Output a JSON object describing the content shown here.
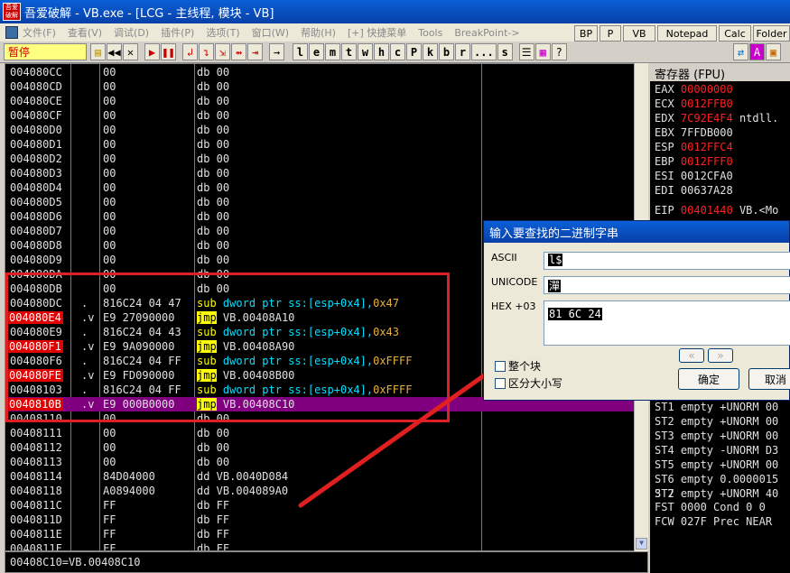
{
  "window": {
    "title": "吾爱破解 - VB.exe - [LCG - 主线程, 模块 - VB]",
    "logo": "吾爱破解"
  },
  "menu": [
    "文件(F)",
    "查看(V)",
    "调试(D)",
    "插件(P)",
    "选项(T)",
    "窗口(W)",
    "帮助(H)",
    "[+] 快捷菜单",
    "Tools",
    "BreakPoint->"
  ],
  "toolbar": {
    "status": "暂停",
    "letters": [
      "l",
      "e",
      "m",
      "t",
      "w",
      "h",
      "c",
      "P",
      "k",
      "b",
      "r",
      "...",
      "s"
    ],
    "right_buttons": [
      "BP",
      "P",
      "VB",
      "Notepad",
      "Calc",
      "Folder"
    ]
  },
  "disasm": [
    {
      "addr": "004080CC",
      "mark": "",
      "hex": "00",
      "dis": "db 00",
      "hl": ""
    },
    {
      "addr": "004080CD",
      "mark": "",
      "hex": "00",
      "dis": "db 00",
      "hl": ""
    },
    {
      "addr": "004080CE",
      "mark": "",
      "hex": "00",
      "dis": "db 00",
      "hl": ""
    },
    {
      "addr": "004080CF",
      "mark": "",
      "hex": "00",
      "dis": "db 00",
      "hl": ""
    },
    {
      "addr": "004080D0",
      "mark": "",
      "hex": "00",
      "dis": "db 00",
      "hl": ""
    },
    {
      "addr": "004080D1",
      "mark": "",
      "hex": "00",
      "dis": "db 00",
      "hl": ""
    },
    {
      "addr": "004080D2",
      "mark": "",
      "hex": "00",
      "dis": "db 00",
      "hl": ""
    },
    {
      "addr": "004080D3",
      "mark": "",
      "hex": "00",
      "dis": "db 00",
      "hl": ""
    },
    {
      "addr": "004080D4",
      "mark": "",
      "hex": "00",
      "dis": "db 00",
      "hl": ""
    },
    {
      "addr": "004080D5",
      "mark": "",
      "hex": "00",
      "dis": "db 00",
      "hl": ""
    },
    {
      "addr": "004080D6",
      "mark": "",
      "hex": "00",
      "dis": "db 00",
      "hl": ""
    },
    {
      "addr": "004080D7",
      "mark": "",
      "hex": "00",
      "dis": "db 00",
      "hl": ""
    },
    {
      "addr": "004080D8",
      "mark": "",
      "hex": "00",
      "dis": "db 00",
      "hl": ""
    },
    {
      "addr": "004080D9",
      "mark": "",
      "hex": "00",
      "dis": "db 00",
      "hl": ""
    },
    {
      "addr": "004080DA",
      "mark": "",
      "hex": "00",
      "dis": "db 00",
      "hl": ""
    },
    {
      "addr": "004080DB",
      "mark": "",
      "hex": "00",
      "dis": "db 00",
      "hl": ""
    },
    {
      "addr": "004080DC",
      "mark": ".",
      "hex": "816C24 04 47",
      "op": "sub",
      "arg": "dword ptr ss:[esp+0x4],",
      "num": "0x47",
      "hl": ""
    },
    {
      "addr": "004080E4",
      "mark": ".v",
      "hex": "E9 27090000",
      "op": "jmp",
      "arg": "VB.00408A10",
      "num": "",
      "hl": "red"
    },
    {
      "addr": "004080E9",
      "mark": ".",
      "hex": "816C24 04 43",
      "op": "sub",
      "arg": "dword ptr ss:[esp+0x4],",
      "num": "0x43",
      "hl": ""
    },
    {
      "addr": "004080F1",
      "mark": ".v",
      "hex": "E9 9A090000",
      "op": "jmp",
      "arg": "VB.00408A90",
      "num": "",
      "hl": "red"
    },
    {
      "addr": "004080F6",
      "mark": ".",
      "hex": "816C24 04 FF",
      "op": "sub",
      "arg": "dword ptr ss:[esp+0x4],",
      "num": "0xFFFF",
      "hl": ""
    },
    {
      "addr": "004080FE",
      "mark": ".v",
      "hex": "E9 FD090000",
      "op": "jmp",
      "arg": "VB.00408B00",
      "num": "",
      "hl": "red"
    },
    {
      "addr": "00408103",
      "mark": ".",
      "hex": "816C24 04 FF",
      "op": "sub",
      "arg": "dword ptr ss:[esp+0x4],",
      "num": "0xFFFF",
      "hl": ""
    },
    {
      "addr": "0040810B",
      "mark": ".v",
      "hex": "E9 000B0000",
      "op": "jmp",
      "arg": "VB.00408C10",
      "num": "",
      "hl": "sel"
    },
    {
      "addr": "00408110",
      "mark": "",
      "hex": "00",
      "dis": "db 00",
      "hl": ""
    },
    {
      "addr": "00408111",
      "mark": "",
      "hex": "00",
      "dis": "db 00",
      "hl": ""
    },
    {
      "addr": "00408112",
      "mark": "",
      "hex": "00",
      "dis": "db 00",
      "hl": ""
    },
    {
      "addr": "00408113",
      "mark": "",
      "hex": "00",
      "dis": "db 00",
      "hl": ""
    },
    {
      "addr": "00408114",
      "mark": "",
      "hex": "84D04000",
      "dis": "dd VB.0040D084",
      "hl": ""
    },
    {
      "addr": "00408118",
      "mark": "",
      "hex": "A0894000",
      "dis": "dd VB.004089A0",
      "hl": ""
    },
    {
      "addr": "0040811C",
      "mark": "",
      "hex": "FF",
      "dis": "db FF",
      "hl": ""
    },
    {
      "addr": "0040811D",
      "mark": "",
      "hex": "FF",
      "dis": "db FF",
      "hl": ""
    },
    {
      "addr": "0040811E",
      "mark": "",
      "hex": "FF",
      "dis": "db FF",
      "hl": ""
    },
    {
      "addr": "0040811F",
      "mark": "",
      "hex": "FF",
      "dis": "db FF",
      "hl": ""
    }
  ],
  "status_line": "00408C10=VB.00408C10",
  "registers": {
    "title": "寄存器 (FPU)",
    "rows": [
      {
        "name": "EAX",
        "val": "00000000",
        "red": true,
        "extra": ""
      },
      {
        "name": "ECX",
        "val": "0012FFB0",
        "red": true,
        "extra": ""
      },
      {
        "name": "EDX",
        "val": "7C92E4F4",
        "red": true,
        "extra": "ntdll."
      },
      {
        "name": "EBX",
        "val": "7FFDB000",
        "red": false,
        "extra": ""
      },
      {
        "name": "ESP",
        "val": "0012FFC4",
        "red": true,
        "extra": ""
      },
      {
        "name": "EBP",
        "val": "0012FFF0",
        "red": true,
        "extra": ""
      },
      {
        "name": "ESI",
        "val": "0012CFA0",
        "red": false,
        "extra": ""
      },
      {
        "name": "EDI",
        "val": "00637A28",
        "red": false,
        "extra": ""
      },
      {
        "name": "EIP",
        "val": "00401440",
        "red": true,
        "extra": "VB.<Mo"
      }
    ],
    "fpu": [
      "ST1 empty +UNORM 00",
      "ST2 empty +UNORM 00",
      "ST3 empty +UNORM 00",
      "ST4 empty -UNORM D3",
      "ST5 empty +UNORM 00",
      "ST6 empty 0.0000015",
      "ST7 empty +UNORM 40",
      "            3 2",
      "FST 0000  Cond 0 0",
      "FCW 027F  Prec NEAR"
    ]
  },
  "dialog": {
    "title": "输入要查找的二进制字串",
    "ascii_label": "ASCII",
    "ascii_value": "l$",
    "unicode_label": "UNICODE",
    "unicode_value": "潬",
    "hex_label": "HEX +03",
    "hex_value": "81 6C 24",
    "chk_block": "整个块",
    "chk_case": "区分大小写",
    "ok": "确定",
    "cancel": "取消"
  }
}
